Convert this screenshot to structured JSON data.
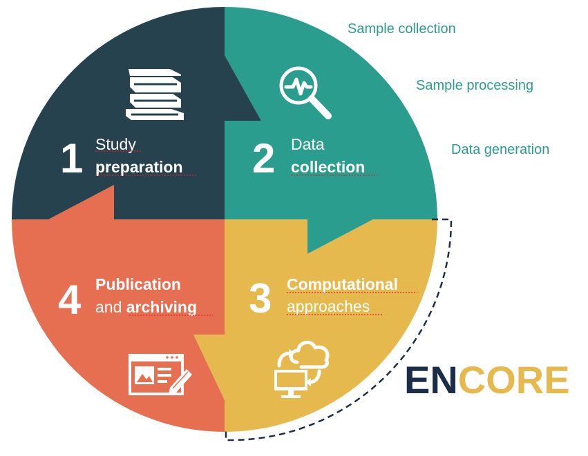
{
  "side_labels": [
    "Sample collection",
    "Sample processing",
    "Data generation"
  ],
  "steps": [
    {
      "number": "1",
      "line1": "Study",
      "line2": "preparation",
      "icon": "books-icon"
    },
    {
      "number": "2",
      "line1": "Data",
      "line2": "collection",
      "icon": "magnifier-pulse-icon"
    },
    {
      "number": "3",
      "line1": "Computational",
      "line2": "approaches",
      "icon": "cloud-computer-sync-icon"
    },
    {
      "number": "4",
      "line1": "Publication",
      "line2_prefix": "and ",
      "line2": "archiving",
      "icon": "publication-pencil-icon"
    }
  ],
  "brand": {
    "part1": "EN",
    "part2": "CORE"
  },
  "colors": {
    "step1": "#26424f",
    "step2": "#2a9d8f",
    "step3": "#e5b94e",
    "step4": "#e76f51",
    "side_label_text": "#2a9d8f",
    "brand_en": "#1b2d48",
    "brand_core": "#e5b94e",
    "dashed_arc": "#1b2d48"
  }
}
